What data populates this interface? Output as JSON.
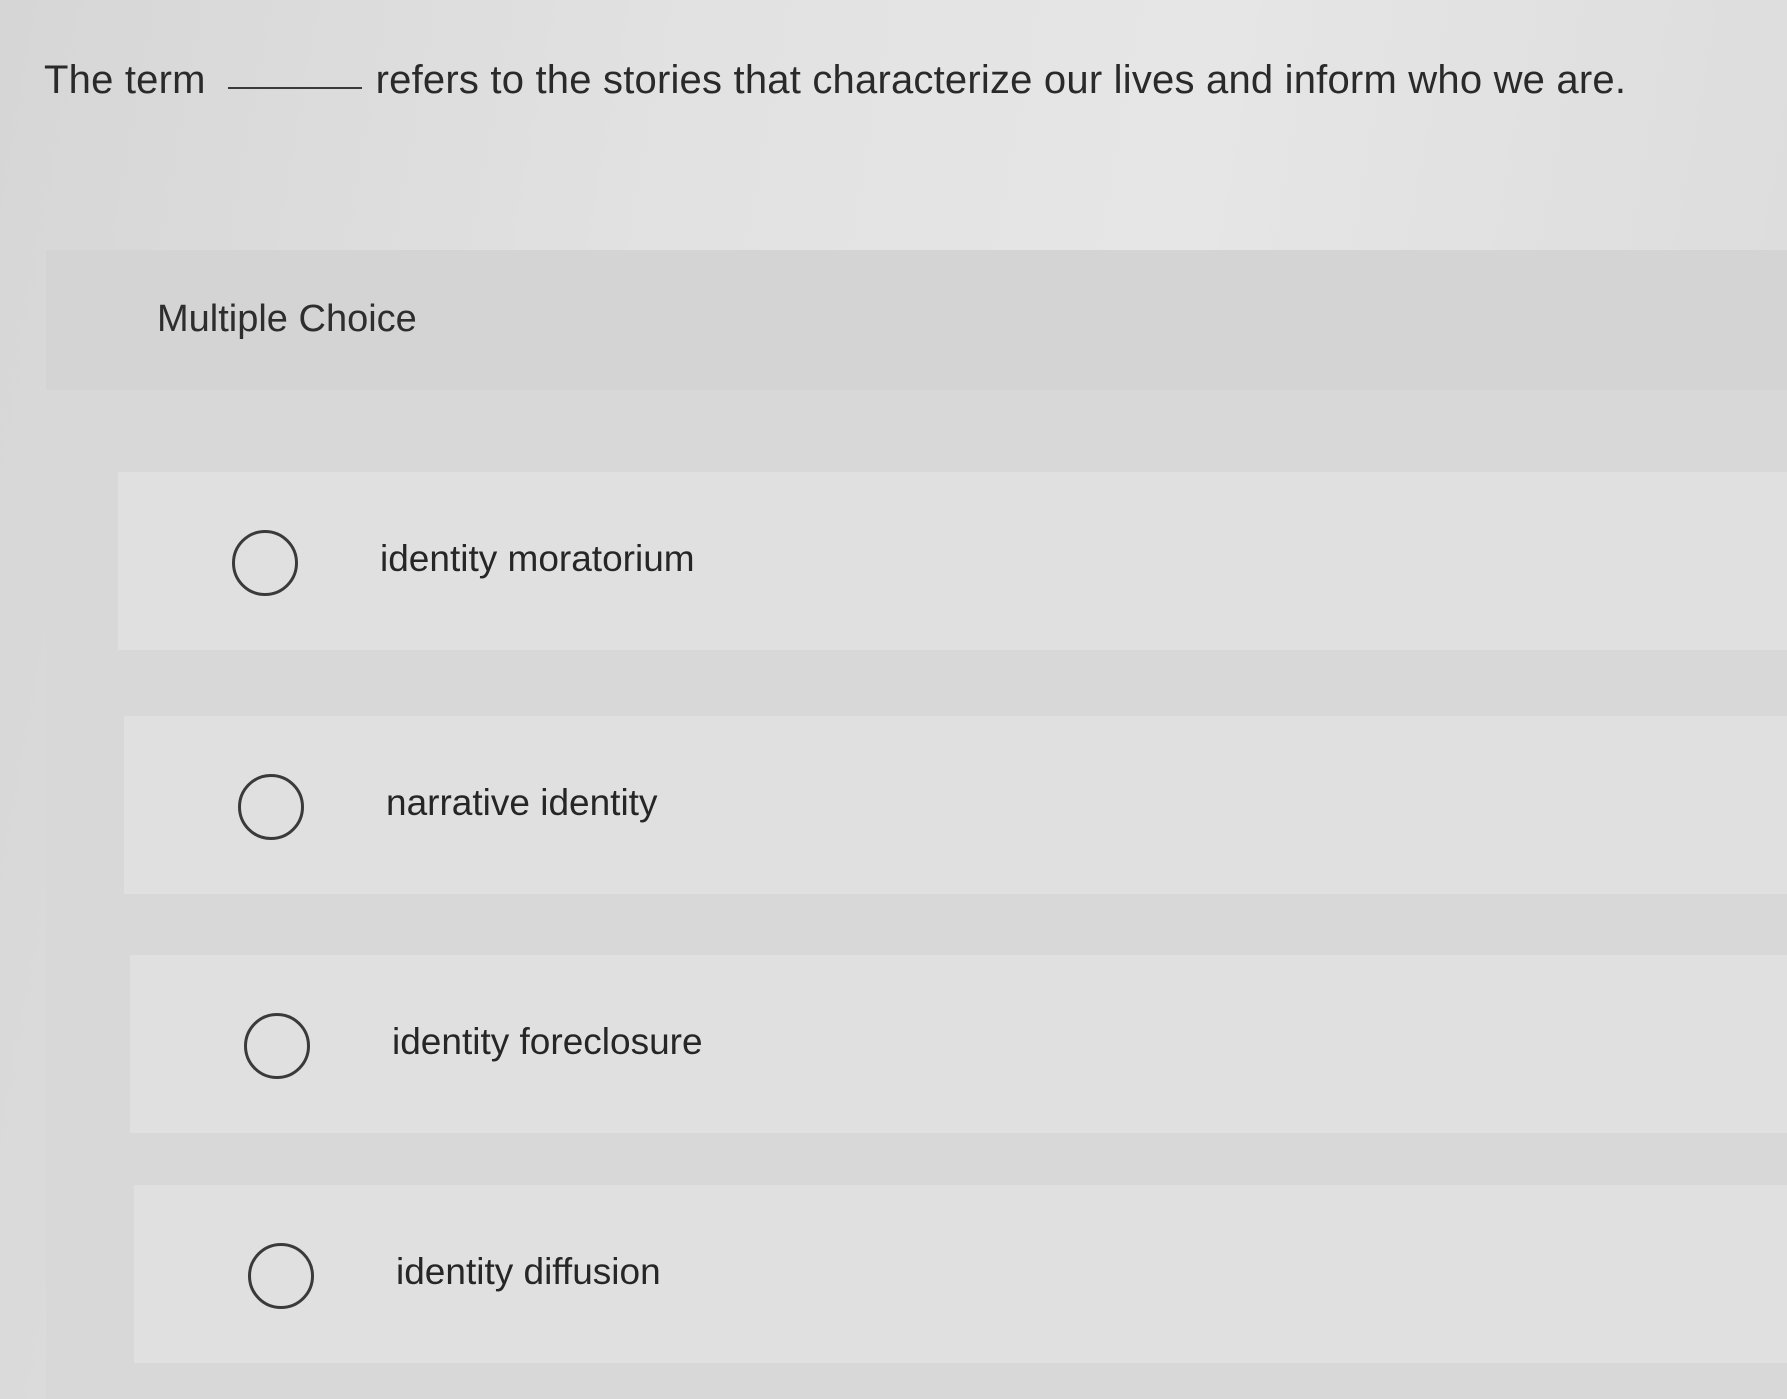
{
  "question": {
    "text_before": "The term",
    "text_after": "refers to the stories that characterize our lives and inform who we are."
  },
  "choices": {
    "heading": "Multiple Choice",
    "options": [
      {
        "label": "identity moratorium",
        "selected": false
      },
      {
        "label": "narrative identity",
        "selected": false
      },
      {
        "label": "identity foreclosure",
        "selected": false
      },
      {
        "label": "identity diffusion",
        "selected": false
      }
    ]
  }
}
